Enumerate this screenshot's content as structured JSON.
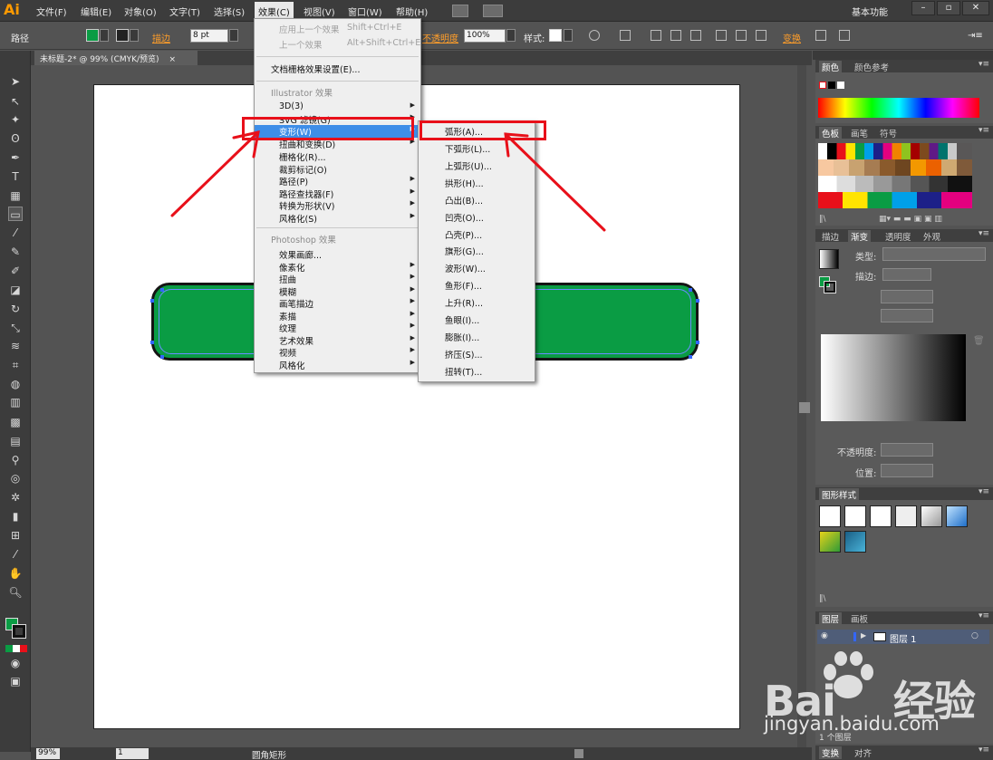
{
  "app": {
    "logo": "Ai",
    "workspace": "基本功能"
  },
  "menubar": {
    "items": [
      "文件(F)",
      "编辑(E)",
      "对象(O)",
      "文字(T)",
      "选择(S)",
      "效果(C)",
      "视图(V)",
      "窗口(W)",
      "帮助(H)"
    ],
    "active": "效果(C)"
  },
  "controlbar": {
    "object_type": "路径",
    "stroke_label": "描边",
    "stroke_weight": "8 pt",
    "opacity_label": "不透明度",
    "opacity_value": "100%",
    "style_label": "样式:",
    "transform_label": "变换"
  },
  "document": {
    "tab_title": "未标题-2* @ 99% (CMYK/预览)",
    "close": "×"
  },
  "effect_menu": {
    "apply_last": "应用上一个效果",
    "apply_last_shortcut": "Shift+Ctrl+E",
    "last_effect": "上一个效果",
    "last_effect_shortcut": "Alt+Shift+Ctrl+E",
    "doc_raster": "文档栅格效果设置(E)...",
    "illustrator_header": "Illustrator 效果",
    "illustrator_items": [
      "3D(3)",
      "SVG 滤镜(G)",
      "变形(W)",
      "扭曲和变换(D)",
      "栅格化(R)...",
      "裁剪标记(O)",
      "路径(P)",
      "路径查找器(F)",
      "转换为形状(V)",
      "风格化(S)"
    ],
    "photoshop_header": "Photoshop 效果",
    "photoshop_items": [
      "效果画廊...",
      "像素化",
      "扭曲",
      "模糊",
      "画笔描边",
      "素描",
      "纹理",
      "艺术效果",
      "视频",
      "风格化"
    ],
    "selected": "变形(W)"
  },
  "warp_menu": {
    "items": [
      "弧形(A)...",
      "下弧形(L)...",
      "上弧形(U)...",
      "拱形(H)...",
      "凸出(B)...",
      "凹壳(O)...",
      "凸壳(P)...",
      "旗形(G)...",
      "波形(W)...",
      "鱼形(F)...",
      "上升(R)...",
      "鱼眼(I)...",
      "膨胀(I)...",
      "挤压(S)...",
      "扭转(T)..."
    ],
    "highlighted": "弧形(A)..."
  },
  "panels": {
    "color_tabs": [
      "颜色",
      "颜色参考"
    ],
    "swatch_tabs": [
      "色板",
      "画笔",
      "符号"
    ],
    "gradient_tabs": [
      "描边",
      "渐变",
      "透明度",
      "外观"
    ],
    "gradient_type_label": "类型:",
    "gradient_stroke_label": "描边:",
    "gradient_opacity_label": "不透明度:",
    "gradient_position_label": "位置:",
    "graphic_styles_tab": "图形样式",
    "layer_tabs": [
      "图层",
      "画板"
    ],
    "layer_name": "图层 1",
    "layer_count": "1 个图层",
    "bottom_tabs": [
      "变换",
      "对齐"
    ]
  },
  "statusbar": {
    "zoom": "99%",
    "page": "1",
    "tool_name": "圆角矩形"
  },
  "watermark": {
    "brand": "Bai",
    "brand_tail": "经验",
    "url": "jingyan.baidu.com"
  },
  "colors": {
    "accent_selected": "#3e8ee8",
    "highlight_red": "#e8101a",
    "shape_fill": "#0a9c44"
  }
}
